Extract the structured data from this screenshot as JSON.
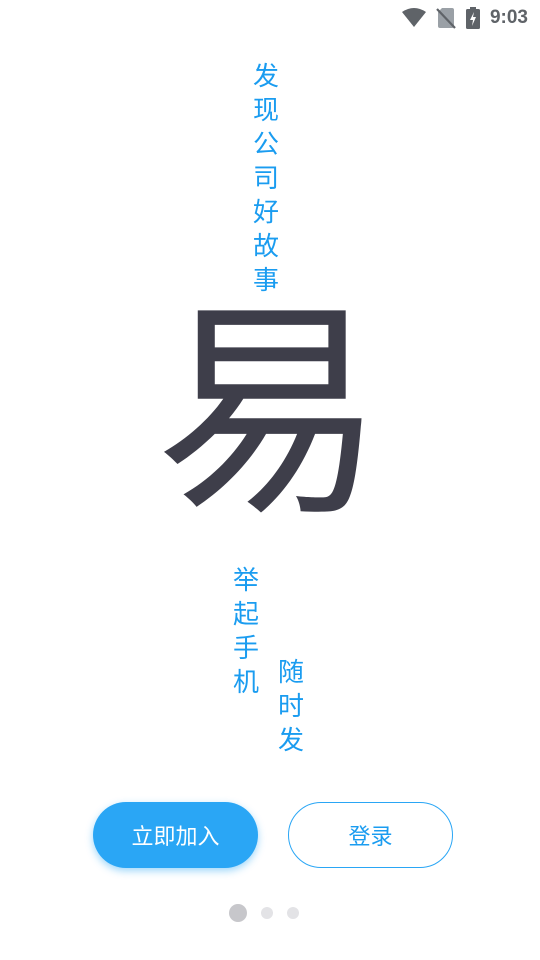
{
  "status_bar": {
    "time": "9:03",
    "icons": [
      "wifi-icon",
      "no-sim-icon",
      "battery-charging-icon"
    ]
  },
  "tagline_top": [
    "发",
    "现",
    "公",
    "司",
    "好",
    "故",
    "事"
  ],
  "hero_character": "易",
  "tagline_left": [
    "举",
    "起",
    "手",
    "机"
  ],
  "tagline_right": [
    "随",
    "时",
    "发"
  ],
  "buttons": {
    "join_label": "立即加入",
    "login_label": "登录"
  },
  "pager": {
    "count": 3,
    "active_index": 0
  },
  "colors": {
    "accent": "#2aa6f5",
    "text_blue": "#1a9cf0",
    "hero": "#3e3e4a"
  }
}
